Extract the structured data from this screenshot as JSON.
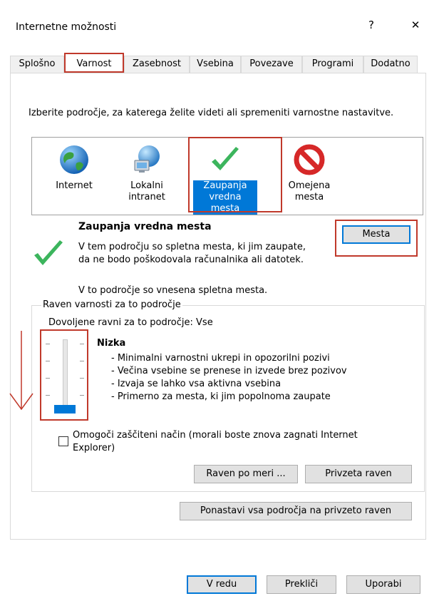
{
  "window": {
    "title": "Internetne možnosti",
    "help_glyph": "?",
    "close_glyph": "✕"
  },
  "tabs": [
    {
      "label": "Splošno"
    },
    {
      "label": "Varnost"
    },
    {
      "label": "Zasebnost"
    },
    {
      "label": "Vsebina"
    },
    {
      "label": "Povezave"
    },
    {
      "label": "Programi"
    },
    {
      "label": "Dodatno"
    }
  ],
  "security": {
    "instruction": "Izberite področje, za katerega želite videti ali spremeniti varnostne nastavitve.",
    "zones": [
      {
        "label": "Internet",
        "icon": "globe-icon"
      },
      {
        "label": "Lokalni intranet",
        "icon": "network-globe-icon"
      },
      {
        "label": "Zaupanja vredna mesta",
        "icon": "checkmark-icon"
      },
      {
        "label": "Omejena mesta",
        "icon": "forbidden-icon"
      }
    ],
    "zone_title": "Zaupanja vredna mesta",
    "zone_description_1": "V tem področju so spletna mesta, ki jim zaupate,",
    "zone_description_2": "da ne bodo poškodovala računalnika ali datotek.",
    "sites_button": "Mesta",
    "zone_note": "V to področje so vnesena spletna mesta.",
    "level_group_label": "Raven varnosti za to področje",
    "allowed_levels": "Dovoljene ravni za to področje: Vse",
    "level_name": "Nizka",
    "level_bullets": [
      "- Minimalni varnostni ukrepi in opozorilni pozivi",
      "- Večina vsebine se prenese in izvede brez pozivov",
      "- Izvaja se lahko vsa aktivna vsebina",
      "- Primerno za mesta, ki jim popolnoma zaupate"
    ],
    "slider_level_fraction": 0.0,
    "protected_mode_label_1": "Omogoči zaščiteni način (morali boste znova zagnati Internet",
    "protected_mode_label_2": "Explorer)",
    "protected_mode_checked": false,
    "custom_level_button": "Raven po meri ...",
    "default_level_button": "Privzeta raven",
    "reset_all_button": "Ponastavi vsa področja na privzeto raven"
  },
  "footer": {
    "ok_button": "V redu",
    "cancel_button": "Prekliči",
    "apply_button": "Uporabi"
  },
  "colors": {
    "highlight_red": "#c0392b",
    "selection_blue": "#0078d7",
    "check_green": "#3cb55d"
  }
}
